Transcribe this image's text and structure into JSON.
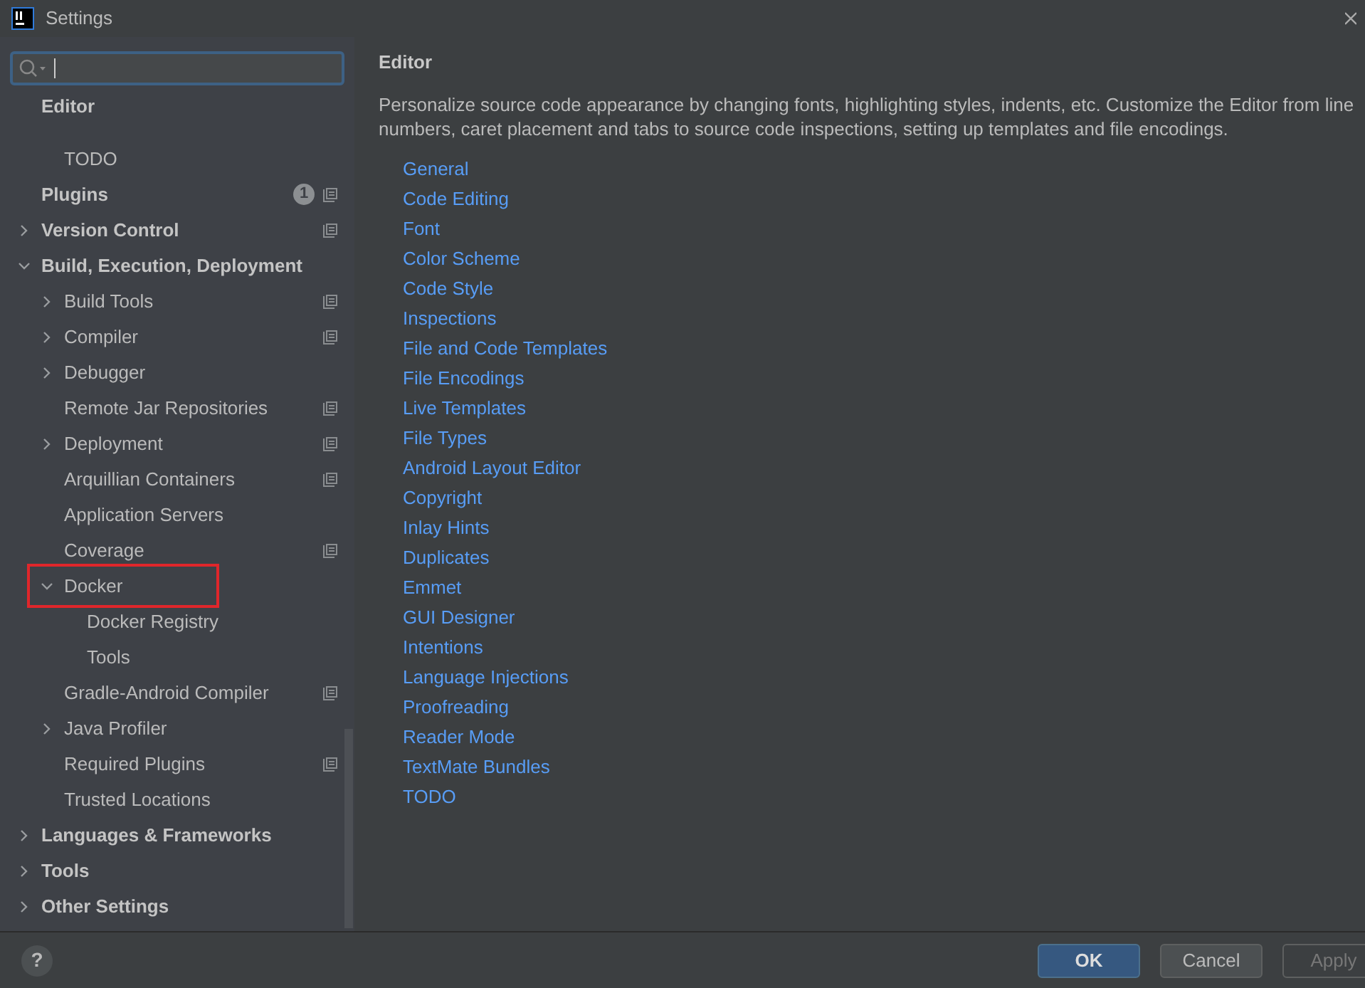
{
  "window": {
    "title": "Settings"
  },
  "tree": [
    {
      "label": "Editor",
      "bold": true,
      "sticky": true,
      "children": [
        {
          "label": "TODO"
        }
      ]
    },
    {
      "label": "Plugins",
      "bold": true,
      "badge": "1",
      "project_icon": true
    },
    {
      "label": "Version Control",
      "bold": true,
      "expanded": false,
      "project_icon": true
    },
    {
      "label": "Build, Execution, Deployment",
      "bold": true,
      "expanded": true,
      "children": [
        {
          "label": "Build Tools",
          "expanded": false,
          "project_icon": true
        },
        {
          "label": "Compiler",
          "expanded": false,
          "project_icon": true
        },
        {
          "label": "Debugger",
          "expanded": false
        },
        {
          "label": "Remote Jar Repositories",
          "project_icon": true
        },
        {
          "label": "Deployment",
          "expanded": false,
          "project_icon": true
        },
        {
          "label": "Arquillian Containers",
          "project_icon": true
        },
        {
          "label": "Application Servers"
        },
        {
          "label": "Coverage",
          "project_icon": true
        },
        {
          "label": "Docker",
          "expanded": true,
          "highlighted": true,
          "children": [
            {
              "label": "Docker Registry"
            },
            {
              "label": "Tools"
            }
          ]
        },
        {
          "label": "Gradle-Android Compiler",
          "project_icon": true
        },
        {
          "label": "Java Profiler",
          "expanded": false
        },
        {
          "label": "Required Plugins",
          "project_icon": true
        },
        {
          "label": "Trusted Locations"
        }
      ]
    },
    {
      "label": "Languages & Frameworks",
      "bold": true,
      "expanded": false
    },
    {
      "label": "Tools",
      "bold": true,
      "expanded": false
    },
    {
      "label": "Other Settings",
      "bold": true,
      "expanded": false
    }
  ],
  "panel": {
    "title": "Editor",
    "description": "Personalize source code appearance by changing fonts, highlighting styles, indents, etc. Customize the Editor from line numbers, caret placement and tabs to source code inspections, setting up templates and file encodings.",
    "links": [
      "General",
      "Code Editing",
      "Font",
      "Color Scheme",
      "Code Style",
      "Inspections",
      "File and Code Templates",
      "File Encodings",
      "Live Templates",
      "File Types",
      "Android Layout Editor",
      "Copyright",
      "Inlay Hints",
      "Duplicates",
      "Emmet",
      "GUI Designer",
      "Intentions",
      "Language Injections",
      "Proofreading",
      "Reader Mode",
      "TextMate Bundles",
      "TODO"
    ]
  },
  "help": {
    "label": "?"
  },
  "buttons": [
    {
      "label": "OK",
      "kind": "primary"
    },
    {
      "label": "Cancel",
      "kind": "normal"
    },
    {
      "label": "Apply",
      "kind": "disabled"
    }
  ]
}
